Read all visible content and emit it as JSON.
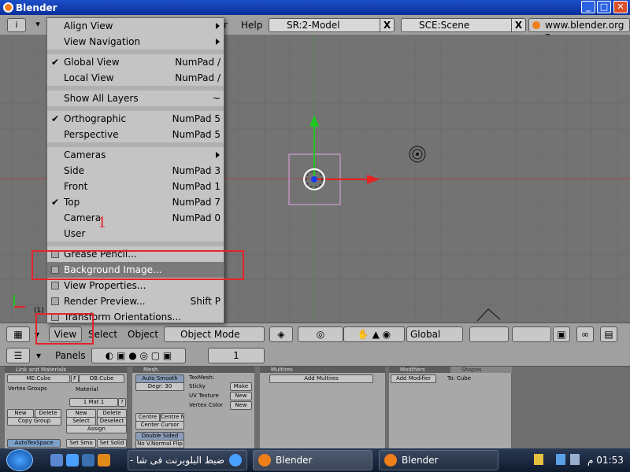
{
  "window": {
    "title": "Blender",
    "min": "_",
    "max": "□",
    "close": "✕"
  },
  "topbar": {
    "menu_tail": "r",
    "help": "Help",
    "screen_field": "SR:2-Model",
    "scene_field": "SCE:Scene",
    "x": "X",
    "url": "www.blender.org 2"
  },
  "view_menu": {
    "items": [
      {
        "label": "Align View",
        "shortcut": "",
        "arrow": true
      },
      {
        "label": "View Navigation",
        "shortcut": "",
        "arrow": true
      },
      {
        "label": "Global View",
        "shortcut": "NumPad /",
        "check": true
      },
      {
        "label": "Local View",
        "shortcut": "NumPad /"
      },
      {
        "label": "Show All Layers",
        "shortcut": "~"
      },
      {
        "label": "Orthographic",
        "shortcut": "NumPad 5",
        "check": true
      },
      {
        "label": "Perspective",
        "shortcut": "NumPad 5"
      },
      {
        "label": "Cameras",
        "shortcut": "",
        "arrow": true
      },
      {
        "label": "Side",
        "shortcut": "NumPad 3"
      },
      {
        "label": "Front",
        "shortcut": "NumPad 1"
      },
      {
        "label": "Top",
        "shortcut": "NumPad 7",
        "check": true
      },
      {
        "label": "Camera",
        "shortcut": "NumPad 0"
      },
      {
        "label": "User",
        "shortcut": ""
      },
      {
        "label": "Grease Pencil...",
        "shortcut": ""
      },
      {
        "label": "Background Image...",
        "shortcut": ""
      },
      {
        "label": "View Properties...",
        "shortcut": ""
      },
      {
        "label": "Render Preview...",
        "shortcut": "Shift P"
      },
      {
        "label": "Transform Orientations...",
        "shortcut": ""
      }
    ],
    "annotation": "1"
  },
  "viewport": {
    "frame_label": "(1)"
  },
  "header3d": {
    "view": "View",
    "select": "Select",
    "object": "Object",
    "mode": "Object Mode",
    "orientation": "Global"
  },
  "buttons_header": {
    "panels": "Panels",
    "frame": "1"
  },
  "panels": {
    "link": {
      "title": "Link and Materials",
      "me": "ME:Cube",
      "f": "F",
      "ob": "OB:Cube",
      "vertex_groups": "Vertex Groups",
      "material": "Material",
      "mat_slot": "1 Mat 1",
      "q": "?",
      "new": "New",
      "delete": "Delete",
      "copy_group": "Copy Group",
      "new2": "New",
      "delete2": "Delete",
      "select": "Select",
      "deselect": "Deselect",
      "assign": "Assign",
      "autotex": "AutoTexSpace",
      "set_smo": "Set Smo",
      "set_solid": "Set Solid"
    },
    "mesh": {
      "title": "Mesh",
      "auto_smooth": "Auto Smooth",
      "degr": "Degr: 30",
      "texmesh": "TexMesh:",
      "sticky": "Sticky",
      "make": "Make",
      "uv_texture": "UV Texture",
      "new_uv": "New",
      "vertex_color": "Vertex Color",
      "new_vc": "New",
      "centre_new": "Centre New",
      "centre_cursor": "Center Cursor",
      "centre": "Centre",
      "double_sided": "Double Sided",
      "no_vnormal": "No V.Normal Flip"
    },
    "multires": {
      "title": "Multires",
      "add": "Add Multires"
    },
    "modifiers": {
      "title": "Modifiers",
      "shapes": "Shapes",
      "add": "Add Modifier",
      "to": "To: Cube"
    }
  },
  "taskbar": {
    "task_ie": "ضبط البلوبرنت فى شا - ...",
    "task_blender1": "Blender",
    "task_blender2": "Blender",
    "clock": "01:53 م"
  }
}
